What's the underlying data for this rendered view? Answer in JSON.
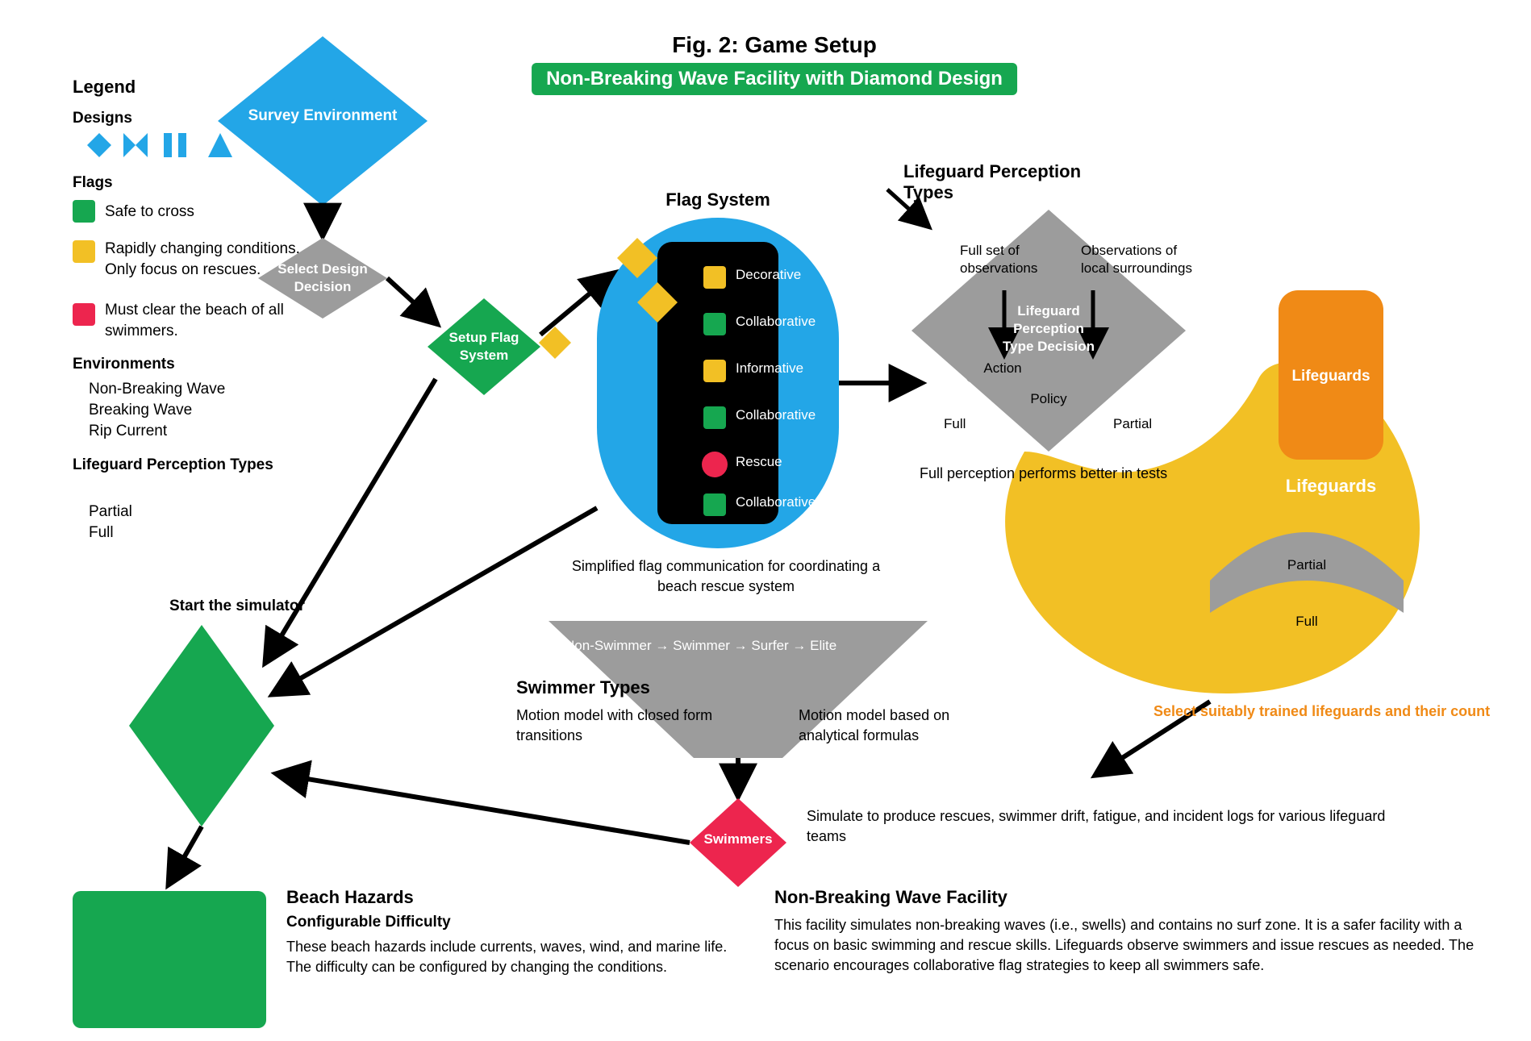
{
  "title_main": "Fig. 2: Game Setup",
  "title_sub": "Non-Breaking Wave Facility with Diamond Design",
  "legend": {
    "title": "Legend",
    "design_label": "Designs",
    "flag_label": "Flags",
    "flag_green": "Safe to cross",
    "flag_yellow": "Rapidly changing conditions. Only focus on rescues.",
    "flag_red": "Must clear the beach of all swimmers.",
    "env_label": "Environments",
    "env_items": [
      "Non-Breaking Wave",
      "Breaking Wave",
      "Rip Current"
    ],
    "lp_label": "Lifeguard Perception Types",
    "lp_items": [
      "Partial",
      "Full"
    ]
  },
  "diagram": {
    "survey_env": "Survey Environment",
    "design_decision": "Select Design\nDecision",
    "setup_flag": "Setup Flag\nSystem",
    "flag_system_title": "Flag System",
    "flag_system_items": [
      "Decorative",
      "Collaborative",
      "Informative",
      "Collaborative",
      "Rescue",
      "Collaborative"
    ],
    "flag_system_note": "Simplified flag communication for coordinating a beach rescue system",
    "perception_decision": "Lifeguard\nPerception\nType Decision",
    "perception_types_title": [
      "Lifeguard Perception Types"
    ],
    "perception_action": "Action",
    "perception_full_obs": "Full set of\nobservations",
    "perception_partial_obs": "Observations of\nlocal surroundings",
    "perception_policy": "Policy",
    "perception_partial": "Partial",
    "perception_full": "Full",
    "perception_note": "Full perception performs better in tests",
    "perception_lifeguards_title": "Lifeguards",
    "perception_lifeguards_note": "Select suitably trained lifeguards and their count",
    "lifeguards_lbl": "Lifeguards",
    "swimmers_title": "Swimmer Types",
    "swimmers_flow": "Non-Swimmer → Swimmer → Surfer → Elite",
    "swimmers_note_a": "Motion model with closed form transitions",
    "swimmers_note_b": "Motion model based on analytical formulas",
    "swimmers_lbl": "Swimmers",
    "start_label": "Start the simulator",
    "hazards_title": "Beach Hazards",
    "hazards_note": "Configurable Difficulty",
    "hazards_body": "These beach hazards include currents, waves, wind, and marine life. The difficulty can be configured by changing the conditions.",
    "facility_title": "Non-Breaking Wave Facility",
    "facility_body": "This facility simulates non-breaking waves (i.e., swells) and contains no surf zone. It is a safer facility with a focus on basic swimming and rescue skills. Lifeguards observe swimmers and issue rescues as needed. The scenario encourages collaborative flag strategies to keep all swimmers safe.",
    "sim_out": "Simulate to produce rescues, swimmer drift, fatigue, and incident logs for various lifeguard teams"
  }
}
